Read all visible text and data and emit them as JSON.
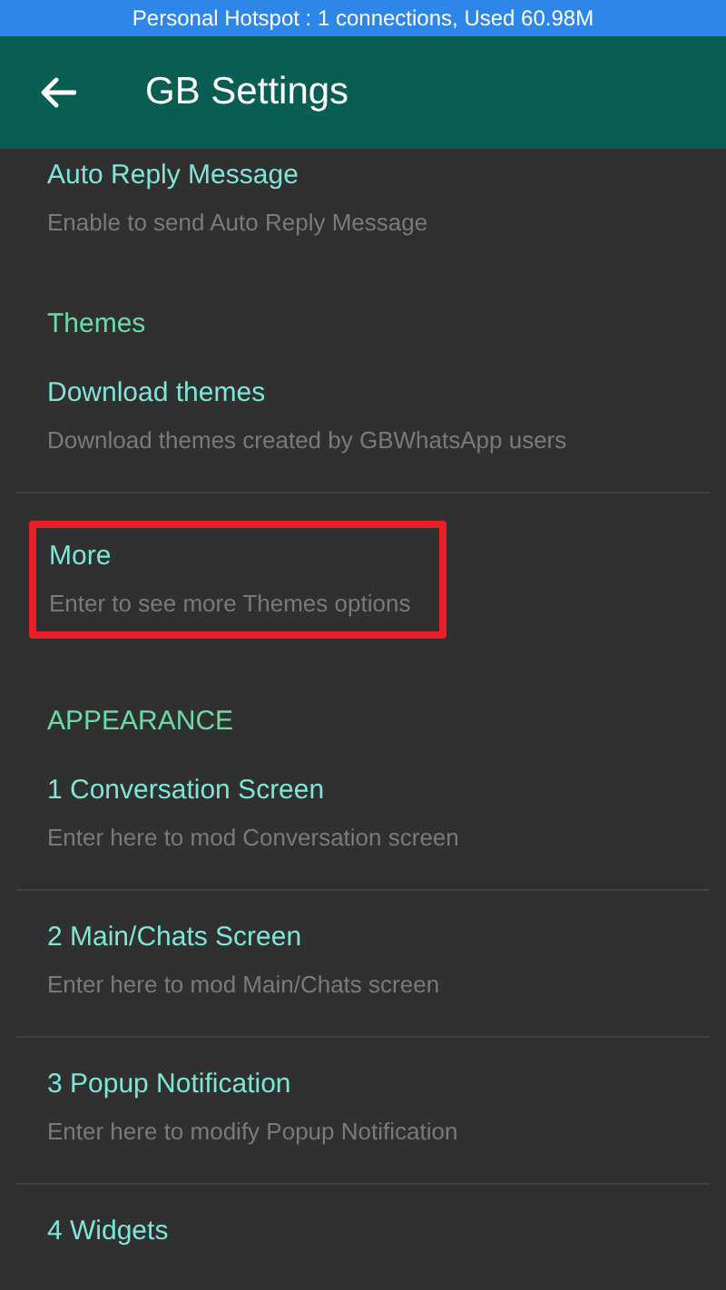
{
  "status_bar": {
    "text": "Personal Hotspot : 1 connections, Used 60.98M"
  },
  "app_bar": {
    "title": "GB Settings"
  },
  "sections": [
    {
      "items": [
        {
          "title": "Auto Reply Message",
          "subtitle": "Enable to send Auto Reply Message",
          "highlighted": false
        }
      ]
    },
    {
      "header": "Themes",
      "items": [
        {
          "title": "Download themes",
          "subtitle": "Download themes created by GBWhatsApp users",
          "highlighted": false
        },
        {
          "title": "More",
          "subtitle": "Enter to see more Themes options",
          "highlighted": true
        }
      ]
    },
    {
      "header": "APPEARANCE",
      "items": [
        {
          "title": "1 Conversation Screen",
          "subtitle": "Enter here to mod Conversation screen",
          "highlighted": false
        },
        {
          "title": "2 Main/Chats Screen",
          "subtitle": "Enter here to mod Main/Chats screen",
          "highlighted": false
        },
        {
          "title": "3 Popup Notification",
          "subtitle": "Enter here to modify Popup Notification",
          "highlighted": false
        },
        {
          "title": "4 Widgets",
          "highlighted": false
        }
      ]
    }
  ]
}
